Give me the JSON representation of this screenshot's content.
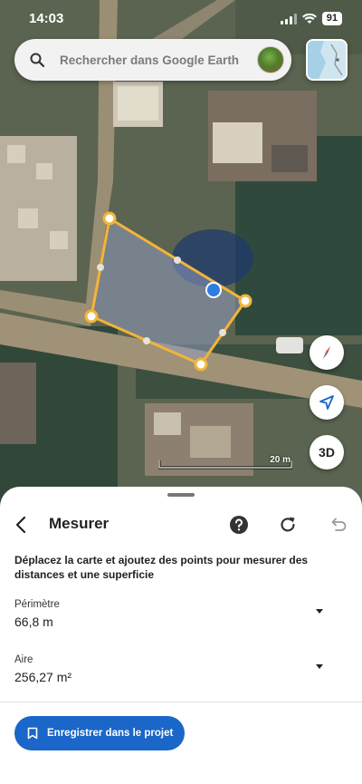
{
  "status_bar": {
    "time": "14:03",
    "battery": "91"
  },
  "search": {
    "placeholder": "Rechercher dans Google Earth"
  },
  "map": {
    "scale_label": "20 m",
    "three_d_label": "3D"
  },
  "sheet": {
    "title": "Mesurer",
    "instructions": "Déplacez la carte et ajoutez des points pour mesurer des distances et une superficie",
    "perimeter": {
      "label": "Périmètre",
      "value": "66,8 m"
    },
    "area": {
      "label": "Aire",
      "value": "256,27 m²"
    },
    "save_label": "Enregistrer dans le projet"
  },
  "icons": {
    "search": "search-icon",
    "back": "chevron-left-icon",
    "help": "help-icon",
    "reset": "refresh-icon",
    "undo": "undo-icon",
    "compass": "compass-icon",
    "locate": "navigation-arrow-icon",
    "dropdown": "caret-down-icon",
    "bookmark": "bookmark-icon"
  },
  "colors": {
    "accent": "#1a66c9",
    "polygon_outline": "#f3b43a",
    "location_dot": "#2f7de1"
  }
}
